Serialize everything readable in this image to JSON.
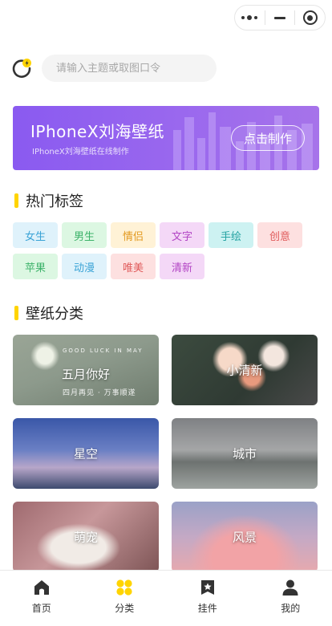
{
  "capsule": {
    "more_icon": "more-dots-icon",
    "minimize_icon": "minus-icon",
    "close_icon": "target-icon"
  },
  "search": {
    "placeholder": "请输入主题或取图口令"
  },
  "banner": {
    "title": "IPhoneX刘海壁纸",
    "subtitle": "IPhoneX刘海壁纸在线制作",
    "button_label": "点击制作"
  },
  "hot_tags": {
    "title": "热门标签",
    "items": [
      {
        "label": "女生",
        "bg": "#dff2fb",
        "color": "#3aa3d6"
      },
      {
        "label": "男生",
        "bg": "#dcf7e2",
        "color": "#3db36a"
      },
      {
        "label": "情侣",
        "bg": "#fff2d6",
        "color": "#e39a20"
      },
      {
        "label": "文字",
        "bg": "#f4d8f7",
        "color": "#b245c4"
      },
      {
        "label": "手绘",
        "bg": "#cdf2f2",
        "color": "#26a3a3"
      },
      {
        "label": "创意",
        "bg": "#fde0e0",
        "color": "#e05b5b"
      },
      {
        "label": "苹果",
        "bg": "#dcf7e2",
        "color": "#3db36a"
      },
      {
        "label": "动漫",
        "bg": "#dff2fb",
        "color": "#3aa3d6"
      },
      {
        "label": "唯美",
        "bg": "#fde0e0",
        "color": "#e05b5b"
      },
      {
        "label": "清新",
        "bg": "#f4d8f7",
        "color": "#b245c4"
      }
    ]
  },
  "categories": {
    "title": "壁纸分类",
    "items": [
      {
        "label": "五月你好",
        "top_text": "GOOD LUCK IN MAY",
        "bottom_text": "四月再见 · 万事顺遂"
      },
      {
        "label": "小清新"
      },
      {
        "label": "星空"
      },
      {
        "label": "城市"
      },
      {
        "label": "萌宠"
      },
      {
        "label": "风景"
      }
    ]
  },
  "tabbar": {
    "items": [
      {
        "label": "首页",
        "icon": "home-icon"
      },
      {
        "label": "分类",
        "icon": "category-grid-icon",
        "color": "#ffd400"
      },
      {
        "label": "挂件",
        "icon": "pendant-star-icon"
      },
      {
        "label": "我的",
        "icon": "user-icon"
      }
    ]
  }
}
